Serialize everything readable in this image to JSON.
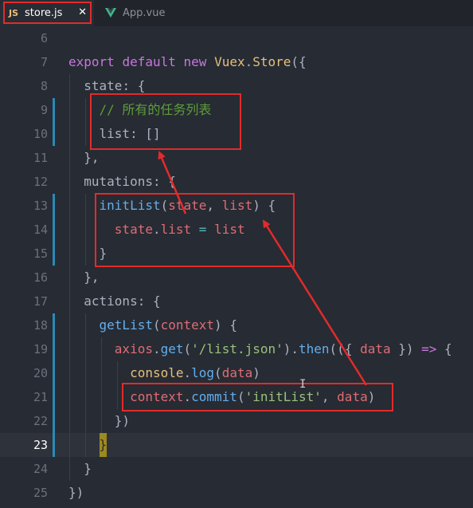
{
  "tabs": [
    {
      "icon": "JS",
      "label": "store.js",
      "close": "✕"
    },
    {
      "label": "App.vue"
    }
  ],
  "lines": [
    {
      "num": "6",
      "tokens": []
    },
    {
      "num": "7",
      "tokens": [
        [
          "kw",
          "export"
        ],
        [
          "pl",
          " "
        ],
        [
          "kw",
          "default"
        ],
        [
          "pl",
          " "
        ],
        [
          "kw",
          "new"
        ],
        [
          "pl",
          " "
        ],
        [
          "ty",
          "Vuex"
        ],
        [
          "pl",
          "."
        ],
        [
          "ty",
          "Store"
        ],
        [
          "pl",
          "({"
        ]
      ]
    },
    {
      "num": "8",
      "tokens": [
        [
          "pl",
          "  "
        ],
        [
          "pl",
          "state"
        ],
        [
          "pl",
          ": {"
        ]
      ]
    },
    {
      "num": "9",
      "tokens": [
        [
          "pl",
          "    "
        ],
        [
          "cm",
          "// 所有的任务列表"
        ]
      ]
    },
    {
      "num": "10",
      "tokens": [
        [
          "pl",
          "    "
        ],
        [
          "pl",
          "list"
        ],
        [
          "pl",
          ": []"
        ]
      ]
    },
    {
      "num": "11",
      "tokens": [
        [
          "pl",
          "  "
        ],
        [
          "pl",
          "},"
        ]
      ]
    },
    {
      "num": "12",
      "tokens": [
        [
          "pl",
          "  "
        ],
        [
          "pl",
          "mutations"
        ],
        [
          "pl",
          ": {"
        ]
      ]
    },
    {
      "num": "13",
      "tokens": [
        [
          "pl",
          "    "
        ],
        [
          "fn",
          "initList"
        ],
        [
          "pl",
          "("
        ],
        [
          "prop",
          "state"
        ],
        [
          "pl",
          ", "
        ],
        [
          "prop",
          "list"
        ],
        [
          "pl",
          ") {"
        ]
      ]
    },
    {
      "num": "14",
      "tokens": [
        [
          "pl",
          "      "
        ],
        [
          "prop",
          "state"
        ],
        [
          "pl",
          "."
        ],
        [
          "prop",
          "list"
        ],
        [
          "pl",
          " "
        ],
        [
          "op",
          "="
        ],
        [
          "pl",
          " "
        ],
        [
          "prop",
          "list"
        ]
      ]
    },
    {
      "num": "15",
      "tokens": [
        [
          "pl",
          "    "
        ],
        [
          "pl",
          "}"
        ]
      ]
    },
    {
      "num": "16",
      "tokens": [
        [
          "pl",
          "  "
        ],
        [
          "pl",
          "},"
        ]
      ]
    },
    {
      "num": "17",
      "tokens": [
        [
          "pl",
          "  "
        ],
        [
          "pl",
          "actions"
        ],
        [
          "pl",
          ": {"
        ]
      ]
    },
    {
      "num": "18",
      "tokens": [
        [
          "pl",
          "    "
        ],
        [
          "fn",
          "getList"
        ],
        [
          "pl",
          "("
        ],
        [
          "prop",
          "context"
        ],
        [
          "pl",
          ") {"
        ]
      ]
    },
    {
      "num": "19",
      "tokens": [
        [
          "pl",
          "      "
        ],
        [
          "prop",
          "axios"
        ],
        [
          "pl",
          "."
        ],
        [
          "fn",
          "get"
        ],
        [
          "pl",
          "("
        ],
        [
          "str",
          "'/list.json'"
        ],
        [
          "pl",
          ")."
        ],
        [
          "fn",
          "then"
        ],
        [
          "pl",
          "(({ "
        ],
        [
          "prop",
          "data"
        ],
        [
          "pl",
          " }) "
        ],
        [
          "kw",
          "=>"
        ],
        [
          "pl",
          " {"
        ]
      ]
    },
    {
      "num": "20",
      "tokens": [
        [
          "pl",
          "        "
        ],
        [
          "ty",
          "console"
        ],
        [
          "pl",
          "."
        ],
        [
          "fn",
          "log"
        ],
        [
          "pl",
          "("
        ],
        [
          "prop",
          "data"
        ],
        [
          "pl",
          ")"
        ]
      ]
    },
    {
      "num": "21",
      "tokens": [
        [
          "pl",
          "        "
        ],
        [
          "prop",
          "context"
        ],
        [
          "pl",
          "."
        ],
        [
          "fn",
          "commit"
        ],
        [
          "pl",
          "("
        ],
        [
          "str",
          "'initList'"
        ],
        [
          "pl",
          ", "
        ],
        [
          "prop",
          "data"
        ],
        [
          "pl",
          ")"
        ]
      ]
    },
    {
      "num": "22",
      "tokens": [
        [
          "pl",
          "      "
        ],
        [
          "pl",
          "})"
        ]
      ]
    },
    {
      "num": "23",
      "tokens": [
        [
          "pl",
          "    "
        ],
        [
          "cur",
          "}"
        ]
      ]
    },
    {
      "num": "24",
      "tokens": [
        [
          "pl",
          "  "
        ],
        [
          "pl",
          "}"
        ]
      ]
    },
    {
      "num": "25",
      "tokens": [
        [
          "pl",
          "})"
        ]
      ]
    }
  ],
  "current_line": "23",
  "colors": {
    "background": "#272b33",
    "annotation": "#e22b2b",
    "keyword": "#c678dd",
    "function": "#61afef",
    "variable": "#e06c75",
    "string": "#98c379",
    "comment": "#5c9e3a"
  }
}
